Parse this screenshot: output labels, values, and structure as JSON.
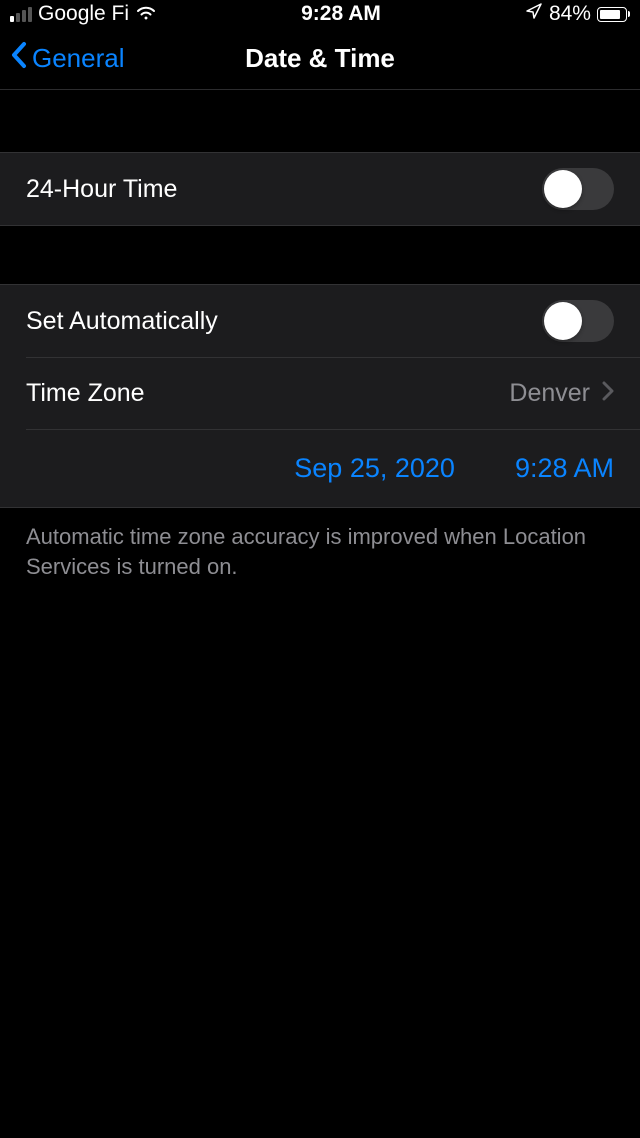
{
  "status": {
    "carrier": "Google Fi",
    "time": "9:28 AM",
    "battery_percent": "84%"
  },
  "nav": {
    "back_label": "General",
    "title": "Date & Time"
  },
  "rows": {
    "hour24_label": "24-Hour Time",
    "set_auto_label": "Set Automatically",
    "timezone_label": "Time Zone",
    "timezone_value": "Denver",
    "date_value": "Sep 25, 2020",
    "time_value": "9:28 AM"
  },
  "toggles": {
    "hour24_on": false,
    "set_auto_on": false
  },
  "footer": "Automatic time zone accuracy is improved when Location Services is turned on.",
  "colors": {
    "accent": "#0a84ff",
    "row_bg": "#1c1c1e",
    "secondary": "#8e8e93"
  }
}
